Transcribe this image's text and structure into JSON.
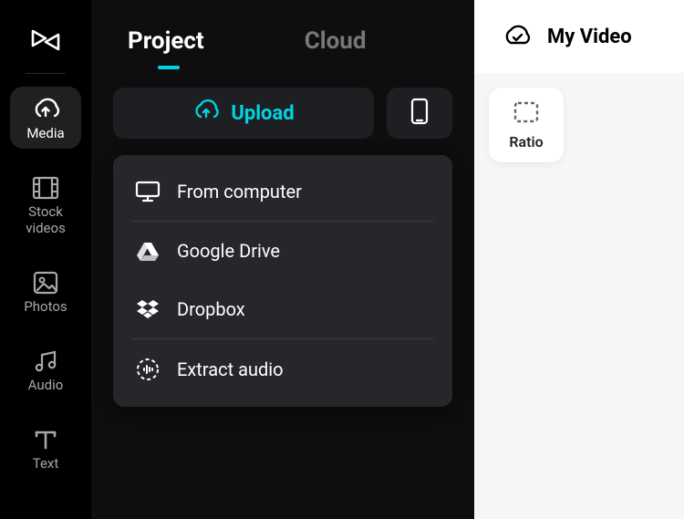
{
  "sidebar": {
    "items": [
      {
        "label": "Media"
      },
      {
        "label": "Stock videos"
      },
      {
        "label": "Photos"
      },
      {
        "label": "Audio"
      },
      {
        "label": "Text"
      }
    ]
  },
  "tabs": {
    "project": "Project",
    "cloud": "Cloud"
  },
  "upload_button_label": "Upload",
  "dropdown": {
    "from_computer": "From computer",
    "google_drive": "Google Drive",
    "dropbox": "Dropbox",
    "extract_audio": "Extract audio"
  },
  "right": {
    "title": "My Video",
    "ratio_label": "Ratio"
  }
}
